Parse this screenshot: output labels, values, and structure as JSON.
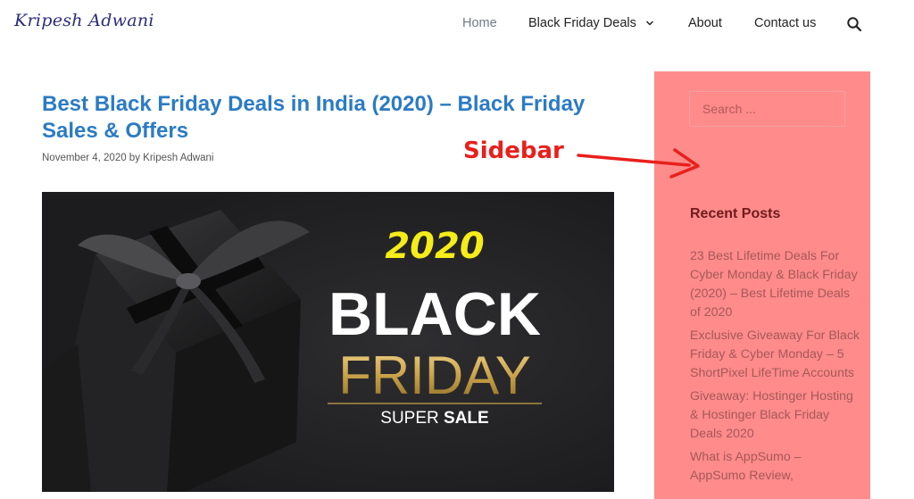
{
  "site": {
    "logo_text": "Kripesh Adwani"
  },
  "nav": {
    "items": [
      {
        "label": "Home",
        "active": true
      },
      {
        "label": "Black Friday Deals",
        "has_dropdown": true
      },
      {
        "label": "About"
      },
      {
        "label": "Contact us"
      }
    ],
    "search_icon": "search-icon",
    "dropdown_icon": "chevron-down-icon"
  },
  "post": {
    "title": "Best Black Friday Deals in India (2020) – Black Friday Sales & Offers",
    "meta": "November 4, 2020 by Kripesh Adwani",
    "hero": {
      "year": "2020",
      "line1": "BLACK",
      "line2": "FRIDAY",
      "tagline_part1": "SUPER",
      "tagline_part2": "SALE"
    }
  },
  "sidebar": {
    "search_placeholder": "Search ...",
    "recent_posts_title": "Recent Posts",
    "recent_posts": [
      "23 Best Lifetime Deals For Cyber Monday & Black Friday (2020) – Best Lifetime Deals of 2020",
      "Exclusive Giveaway For Black Friday & Cyber Monday – 5 ShortPixel LifeTime Accounts",
      "Giveaway: Hostinger Hosting & Hostinger Black Friday Deals 2020",
      "What is AppSumo – AppSumo Review,"
    ]
  },
  "annotation": {
    "label": "Sidebar",
    "color": "#e8201c"
  },
  "colors": {
    "link": "#2b7bc4",
    "sidebar_bg": "#ff8b8b",
    "hero_year": "#f5ec1a",
    "hero_gold": "#c9a24a"
  }
}
